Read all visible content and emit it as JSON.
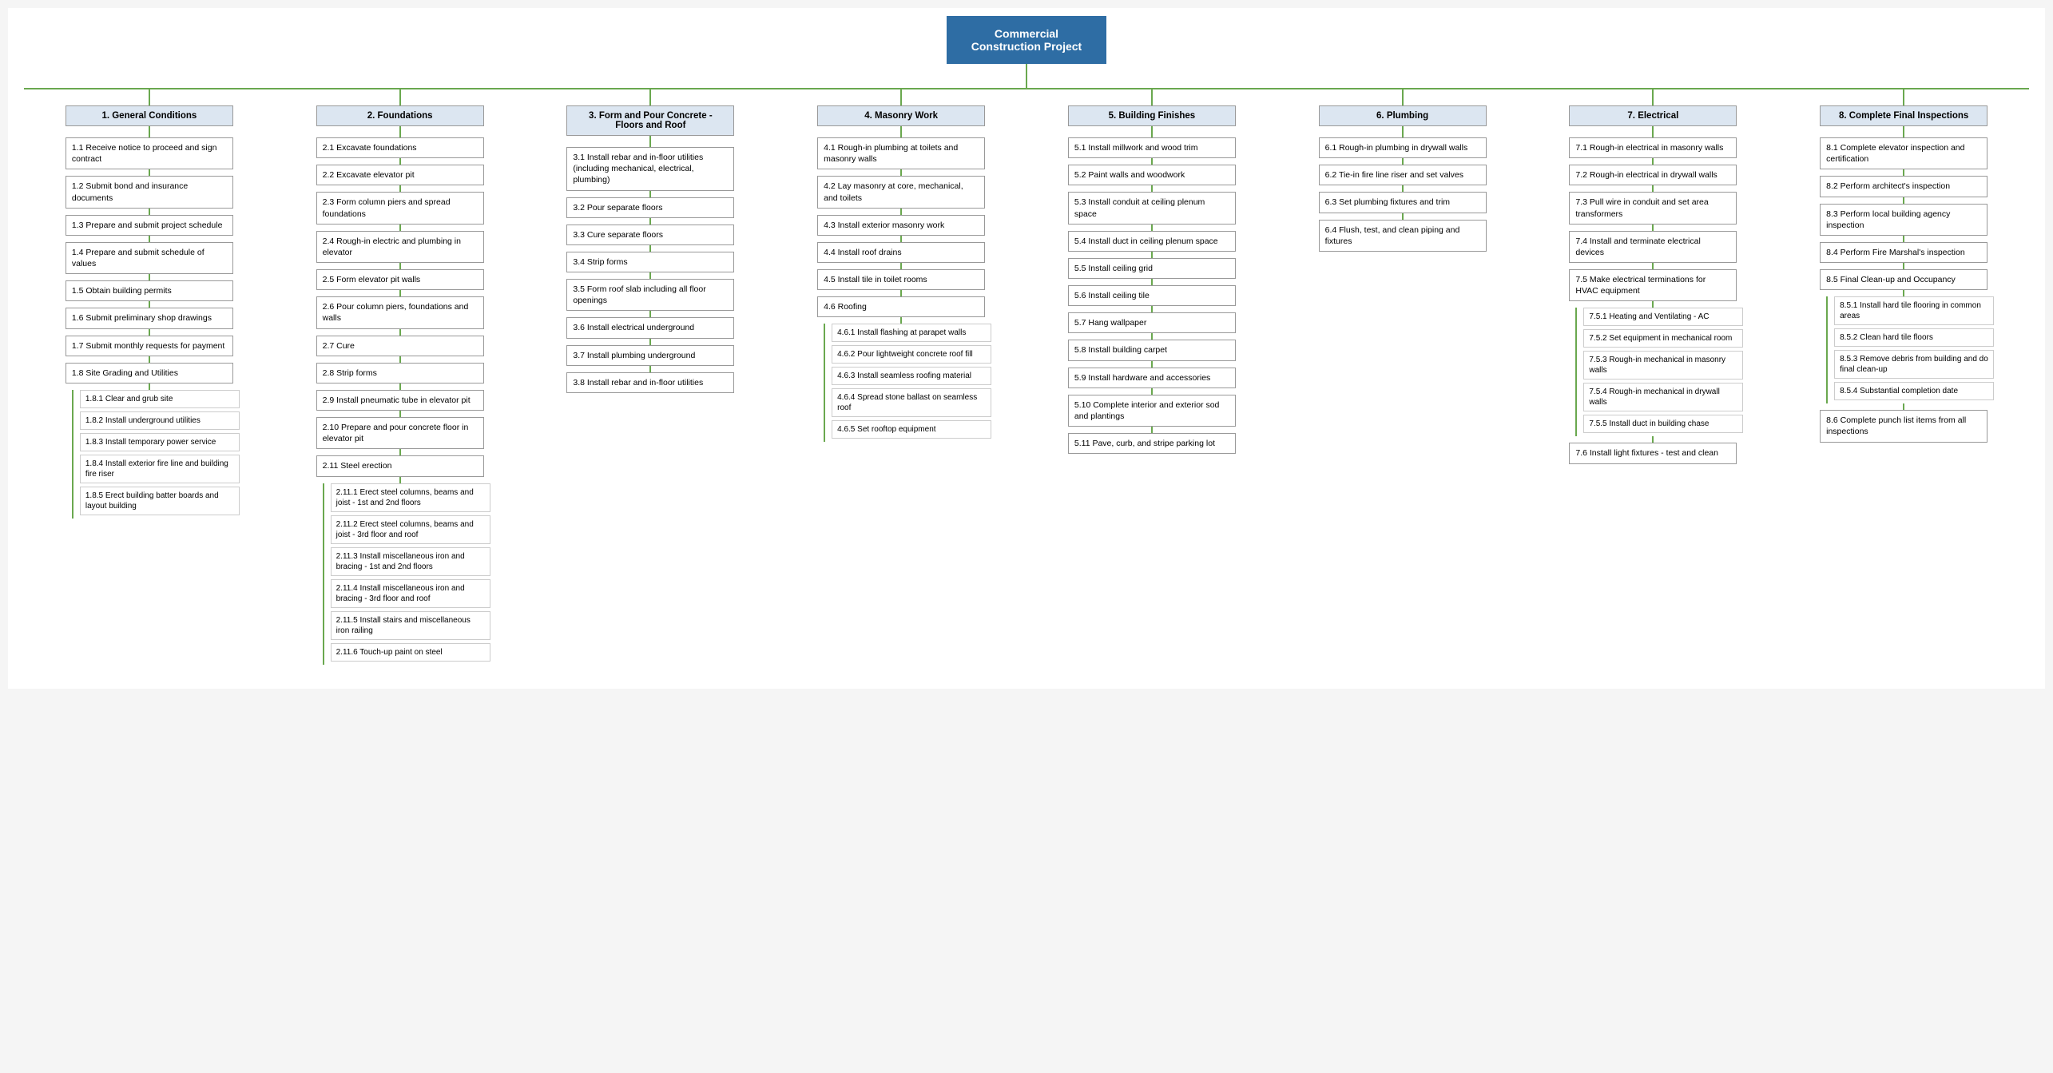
{
  "title": "Commercial Construction Project",
  "columns": [
    {
      "id": "col1",
      "header": "1.  General Conditions",
      "items": [
        {
          "id": "1.1",
          "text": "1.1  Receive notice to proceed and sign contract"
        },
        {
          "id": "1.2",
          "text": "1.2  Submit bond and insurance documents"
        },
        {
          "id": "1.3",
          "text": "1.3  Prepare and submit project schedule"
        },
        {
          "id": "1.4",
          "text": "1.4  Prepare and submit schedule of values"
        },
        {
          "id": "1.5",
          "text": "1.5  Obtain building permits"
        },
        {
          "id": "1.6",
          "text": "1.6  Submit preliminary shop drawings"
        },
        {
          "id": "1.7",
          "text": "1.7  Submit monthly requests for payment"
        },
        {
          "id": "1.8",
          "text": "1.8  Site Grading and Utilities",
          "subitems": [
            {
              "id": "1.8.1",
              "text": "1.8.1  Clear and grub site"
            },
            {
              "id": "1.8.2",
              "text": "1.8.2  Install underground utilities"
            },
            {
              "id": "1.8.3",
              "text": "1.8.3  Install temporary power service"
            },
            {
              "id": "1.8.4",
              "text": "1.8.4  Install exterior fire line and building fire riser"
            },
            {
              "id": "1.8.5",
              "text": "1.8.5  Erect building batter boards and layout building"
            }
          ]
        }
      ]
    },
    {
      "id": "col2",
      "header": "2.  Foundations",
      "items": [
        {
          "id": "2.1",
          "text": "2.1  Excavate foundations"
        },
        {
          "id": "2.2",
          "text": "2.2  Excavate elevator pit"
        },
        {
          "id": "2.3",
          "text": "2.3  Form column piers and spread foundations"
        },
        {
          "id": "2.4",
          "text": "2.4  Rough-in electric and plumbing in elevator"
        },
        {
          "id": "2.5",
          "text": "2.5  Form elevator pit walls"
        },
        {
          "id": "2.6",
          "text": "2.6  Pour column piers, foundations and walls"
        },
        {
          "id": "2.7",
          "text": "2.7  Cure"
        },
        {
          "id": "2.8",
          "text": "2.8  Strip forms"
        },
        {
          "id": "2.9",
          "text": "2.9  Install pneumatic tube in elevator pit"
        },
        {
          "id": "2.10",
          "text": "2.10  Prepare and pour concrete floor in elevator pit"
        },
        {
          "id": "2.11",
          "text": "2.11  Steel erection",
          "subitems": [
            {
              "id": "2.11.1",
              "text": "2.11.1  Erect steel columns, beams and joist - 1st and 2nd floors"
            },
            {
              "id": "2.11.2",
              "text": "2.11.2  Erect steel columns, beams and joist - 3rd floor and roof"
            },
            {
              "id": "2.11.3",
              "text": "2.11.3  Install miscellaneous iron and bracing - 1st and 2nd floors"
            },
            {
              "id": "2.11.4",
              "text": "2.11.4  Install miscellaneous iron and bracing - 3rd floor and roof"
            },
            {
              "id": "2.11.5",
              "text": "2.11.5  Install stairs and miscellaneous iron railing"
            },
            {
              "id": "2.11.6",
              "text": "2.11.6  Touch-up paint on steel"
            }
          ]
        }
      ]
    },
    {
      "id": "col3",
      "header": "3.  Form and Pour Concrete - Floors and Roof",
      "items": [
        {
          "id": "3.1",
          "text": "3.1  Install rebar and in-floor utilities (including mechanical, electrical, plumbing)"
        },
        {
          "id": "3.2",
          "text": "3.2  Pour separate floors"
        },
        {
          "id": "3.3",
          "text": "3.3  Cure separate floors"
        },
        {
          "id": "3.4",
          "text": "3.4  Strip forms"
        },
        {
          "id": "3.5",
          "text": "3.5  Form roof slab including all floor openings"
        },
        {
          "id": "3.6",
          "text": "3.6  Install electrical underground"
        },
        {
          "id": "3.7",
          "text": "3.7  Install plumbing underground"
        },
        {
          "id": "3.8",
          "text": "3.8  Install rebar and in-floor utilities"
        }
      ]
    },
    {
      "id": "col4",
      "header": "4.  Masonry Work",
      "items": [
        {
          "id": "4.1",
          "text": "4.1  Rough-in plumbing at toilets and masonry walls"
        },
        {
          "id": "4.2",
          "text": "4.2  Lay masonry at core, mechanical, and toilets"
        },
        {
          "id": "4.3",
          "text": "4.3  Install exterior masonry work"
        },
        {
          "id": "4.4",
          "text": "4.4  Install roof drains"
        },
        {
          "id": "4.5",
          "text": "4.5  Install tile in toilet rooms"
        },
        {
          "id": "4.6",
          "text": "4.6  Roofing",
          "subitems": [
            {
              "id": "4.6.1",
              "text": "4.6.1  Install flashing at parapet walls"
            },
            {
              "id": "4.6.2",
              "text": "4.6.2  Pour lightweight concrete roof fill"
            },
            {
              "id": "4.6.3",
              "text": "4.6.3  Install seamless roofing material"
            },
            {
              "id": "4.6.4",
              "text": "4.6.4  Spread stone ballast on seamless roof"
            },
            {
              "id": "4.6.5",
              "text": "4.6.5  Set rooftop equipment"
            }
          ]
        }
      ]
    },
    {
      "id": "col5",
      "header": "5.  Building Finishes",
      "items": [
        {
          "id": "5.1",
          "text": "5.1  Install millwork and wood trim"
        },
        {
          "id": "5.2",
          "text": "5.2  Paint walls and woodwork"
        },
        {
          "id": "5.3",
          "text": "5.3  Install conduit at ceiling plenum space"
        },
        {
          "id": "5.4",
          "text": "5.4  Install duct in ceiling plenum space"
        },
        {
          "id": "5.5",
          "text": "5.5  Install ceiling grid"
        },
        {
          "id": "5.6",
          "text": "5.6  Install ceiling tile"
        },
        {
          "id": "5.7",
          "text": "5.7  Hang wallpaper"
        },
        {
          "id": "5.8",
          "text": "5.8  Install building carpet"
        },
        {
          "id": "5.9",
          "text": "5.9  Install hardware and accessories"
        },
        {
          "id": "5.10",
          "text": "5.10  Complete interior and exterior sod and plantings"
        },
        {
          "id": "5.11",
          "text": "5.11  Pave, curb, and stripe parking lot"
        }
      ]
    },
    {
      "id": "col6",
      "header": "6.  Plumbing",
      "items": [
        {
          "id": "6.1",
          "text": "6.1  Rough-in plumbing in drywall walls"
        },
        {
          "id": "6.2",
          "text": "6.2  Tie-in fire line riser and set valves"
        },
        {
          "id": "6.3",
          "text": "6.3  Set plumbing fixtures and trim"
        },
        {
          "id": "6.4",
          "text": "6.4  Flush, test, and clean piping and fixtures"
        }
      ]
    },
    {
      "id": "col7",
      "header": "7.  Electrical",
      "items": [
        {
          "id": "7.1",
          "text": "7.1  Rough-in electrical in masonry walls"
        },
        {
          "id": "7.2",
          "text": "7.2  Rough-in electrical in drywall walls"
        },
        {
          "id": "7.3",
          "text": "7.3  Pull wire in conduit and set area transformers"
        },
        {
          "id": "7.4",
          "text": "7.4  Install and terminate electrical devices"
        },
        {
          "id": "7.5",
          "text": "7.5  Make electrical terminations for HVAC equipment",
          "subitems": [
            {
              "id": "7.5.1",
              "text": "7.5.1  Heating and Ventilating - AC"
            },
            {
              "id": "7.5.2",
              "text": "7.5.2  Set equipment in mechanical room"
            },
            {
              "id": "7.5.3",
              "text": "7.5.3  Rough-in mechanical in masonry walls"
            },
            {
              "id": "7.5.4",
              "text": "7.5.4  Rough-in mechanical in drywall walls"
            },
            {
              "id": "7.5.5",
              "text": "7.5.5  Install duct in building chase"
            }
          ]
        },
        {
          "id": "7.6",
          "text": "7.6  Install light fixtures - test and clean"
        }
      ]
    },
    {
      "id": "col8",
      "header": "8.  Complete Final Inspections",
      "items": [
        {
          "id": "8.1",
          "text": "8.1  Complete elevator inspection and certification"
        },
        {
          "id": "8.2",
          "text": "8.2  Perform architect's inspection"
        },
        {
          "id": "8.3",
          "text": "8.3  Perform local building agency inspection"
        },
        {
          "id": "8.4",
          "text": "8.4  Perform Fire Marshal's inspection"
        },
        {
          "id": "8.5",
          "text": "8.5  Final Clean-up and Occupancy",
          "subitems": [
            {
              "id": "8.5.1",
              "text": "8.5.1  Install hard tile flooring in common areas"
            },
            {
              "id": "8.5.2",
              "text": "8.5.2  Clean hard tile floors"
            },
            {
              "id": "8.5.3",
              "text": "8.5.3  Remove debris from building and do final clean-up"
            },
            {
              "id": "8.5.4",
              "text": "8.5.4  Substantial completion date"
            }
          ]
        },
        {
          "id": "8.6",
          "text": "8.6  Complete punch list items from all inspections"
        }
      ]
    }
  ]
}
